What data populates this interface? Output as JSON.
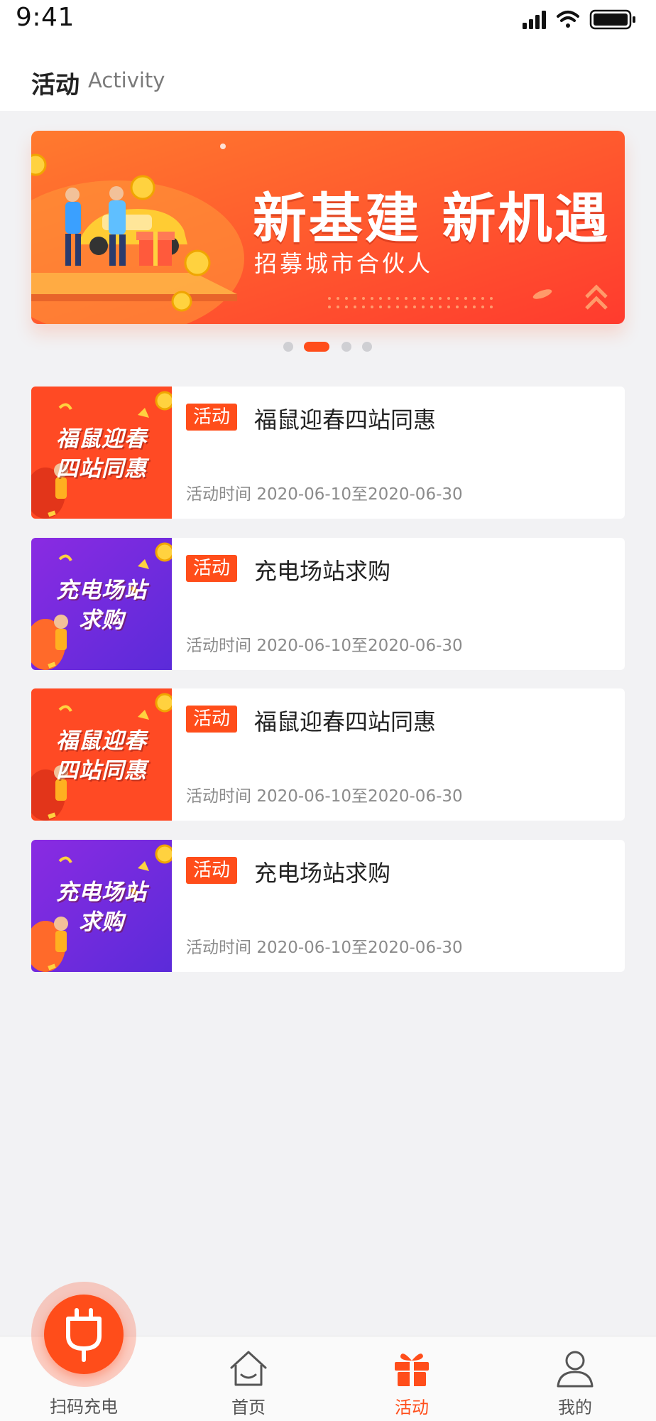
{
  "status_bar": {
    "time": "9:41"
  },
  "header": {
    "title": "活动",
    "subtitle": "Activity"
  },
  "banner": {
    "headline": "新基建 新机遇",
    "subheadline": "招募城市合伙人",
    "page_count": 4,
    "active_index": 1,
    "colors": {
      "start": "#ff7a2e",
      "end": "#ff3b2e"
    }
  },
  "activities": [
    {
      "tag": "活动",
      "title": "福鼠迎春四站同惠",
      "time_label": "活动时间",
      "time_range": "2020-06-10至2020-06-30",
      "thumb_text": [
        "福鼠迎春",
        "四站同惠"
      ],
      "thumb_theme": "red"
    },
    {
      "tag": "活动",
      "title": "充电场站求购",
      "time_label": "活动时间",
      "time_range": "2020-06-10至2020-06-30",
      "thumb_text": [
        "充电场站",
        "求购"
      ],
      "thumb_theme": "purple"
    },
    {
      "tag": "活动",
      "title": "福鼠迎春四站同惠",
      "time_label": "活动时间",
      "time_range": "2020-06-10至2020-06-30",
      "thumb_text": [
        "福鼠迎春",
        "四站同惠"
      ],
      "thumb_theme": "red"
    },
    {
      "tag": "活动",
      "title": "充电场站求购",
      "time_label": "活动时间",
      "time_range": "2020-06-10至2020-06-30",
      "thumb_text": [
        "充电场站",
        "求购"
      ],
      "thumb_theme": "purple"
    }
  ],
  "tabbar": {
    "scan": {
      "label": "扫码充电",
      "icon": "plug-icon"
    },
    "tabs": [
      {
        "label": "首页",
        "icon": "home-icon",
        "active": false
      },
      {
        "label": "活动",
        "icon": "gift-icon",
        "active": true
      },
      {
        "label": "我的",
        "icon": "user-icon",
        "active": false
      }
    ]
  },
  "colors": {
    "accent": "#ff4d1a",
    "page_bg": "#f2f2f4",
    "purple_start": "#8a2be2",
    "purple_end": "#5b2bd9"
  }
}
